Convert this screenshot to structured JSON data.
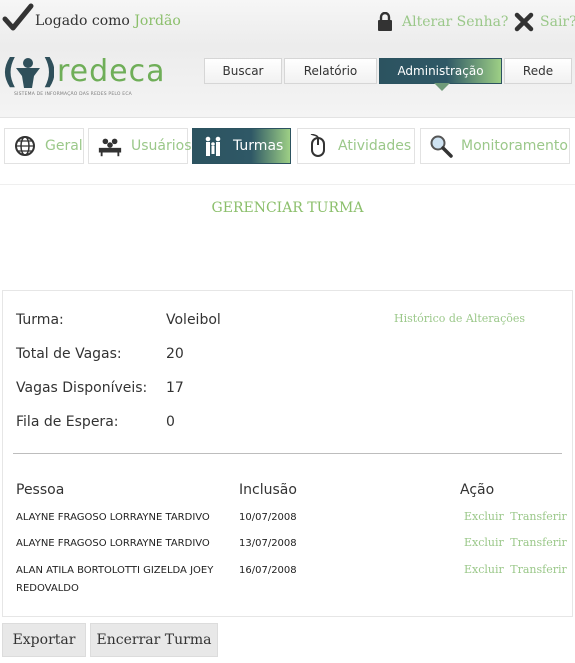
{
  "topbar": {
    "logged_prefix": "Logado como",
    "user": "Jordão",
    "change_password": "Alterar Senha?",
    "logout": "Sair?"
  },
  "logo": {
    "mark": "(•)",
    "word": "redeca",
    "subtitle": "SISTEMA DE INFORMAÇÃO DAS REDES PELO ECA"
  },
  "main_nav": [
    {
      "label": "Buscar"
    },
    {
      "label": "Relatório"
    },
    {
      "label": "Administração",
      "active": true
    },
    {
      "label": "Rede"
    }
  ],
  "tabs": [
    {
      "label": "Geral",
      "icon": "globe-icon"
    },
    {
      "label": "Usuários",
      "icon": "users-icon"
    },
    {
      "label": "Turmas",
      "icon": "family-icon",
      "active": true
    },
    {
      "label": "Atividades",
      "icon": "mouse-icon"
    },
    {
      "label": "Monitoramento",
      "icon": "magnifier-icon"
    }
  ],
  "page_title": "GERENCIAR TURMA",
  "details": {
    "history_link": "Histórico de Alterações",
    "fields": [
      {
        "label": "Turma:",
        "value": "Voleibol"
      },
      {
        "label": "Total de Vagas:",
        "value": "20"
      },
      {
        "label": "Vagas Disponíveis:",
        "value": "17"
      },
      {
        "label": "Fila de Espera:",
        "value": "0"
      }
    ]
  },
  "table": {
    "headers": [
      "Pessoa",
      "Inclusão",
      "Ação"
    ],
    "rows": [
      {
        "person": "ALAYNE FRAGOSO LORRAYNE TARDIVO",
        "date": "10/07/2008",
        "delete": "Excluir",
        "transfer": "Transferir"
      },
      {
        "person": "ALAYNE FRAGOSO LORRAYNE TARDIVO",
        "date": "13/07/2008",
        "delete": "Excluir",
        "transfer": "Transferir"
      },
      {
        "person": "ALAN ATILA BORTOLOTTI GIZELDA JOEY REDOVALDO",
        "date": "16/07/2008",
        "delete": "Excluir",
        "transfer": "Transferir"
      }
    ]
  },
  "buttons": {
    "export": "Exportar",
    "close_class": "Encerrar Turma"
  },
  "colors": {
    "accent_green": "#8bbf6b",
    "nav_dark": "#2c5360"
  }
}
